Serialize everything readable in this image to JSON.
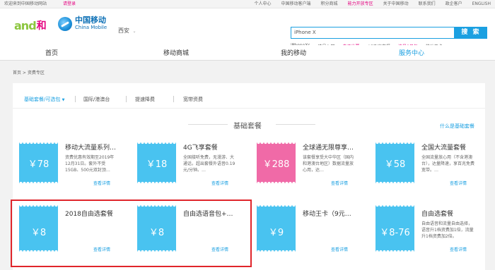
{
  "topbar": {
    "welcome": "欢迎来到中国移动网站",
    "login": "请登录",
    "links": [
      "个人中心",
      "中国移动客户端",
      "积分商城",
      "能力开放专区",
      "关于中国移动",
      "联系我们",
      "政企客户",
      "ENGLISH"
    ],
    "highlight_index": 3
  },
  "header": {
    "logo_and": "and",
    "logo_he": "和",
    "brand_cn": "中国移动",
    "brand_en": "China Mobile",
    "city": "西安",
    "search_value": "iPhone X",
    "search_button": "搜 索",
    "hotwords": [
      "iPhoneXs",
      "选号入网",
      "电子发票",
      "4G飞享套餐",
      "流量0日包",
      "移动王卡"
    ]
  },
  "nav": {
    "items": [
      "首页",
      "移动商城",
      "我的移动",
      "服务中心"
    ],
    "active_index": 3
  },
  "breadcrumb": "首页 > 资费专区",
  "tabs": [
    "基础套餐/可选包",
    "国际/港澳台",
    "提速降费",
    "宽带资费"
  ],
  "section": {
    "title": "基础套餐",
    "link": "什么是基础套餐"
  },
  "detail_label": "查看详情",
  "cards": [
    {
      "name": "移动大流量系列…",
      "price": "￥78",
      "desc": "资费优惠有效期至2019年12月31日。套外不受15GB、500元双封顶…"
    },
    {
      "name": "4G飞享套餐",
      "price": "￥18",
      "desc": "全国接听免费，无漫游、大通话，超出套餐外语音0.19元/分钟。…"
    },
    {
      "name": "全球通无限尊享…",
      "price": "￥288",
      "desc": "该套餐享受大中华区（国内和港澳台地区）数据流量放心用，达…"
    },
    {
      "name": "全国大流量套餐",
      "price": "￥58",
      "desc": "全国流量放心用（不含港澳台），达量降速，享百兆免费宽带。…"
    },
    {
      "name": "2018自由选套餐",
      "price": "￥8",
      "desc": ""
    },
    {
      "name": "自由选语音包+…",
      "price": "￥8",
      "desc": ""
    },
    {
      "name": "移动王卡（9元…",
      "price": "￥9",
      "desc": ""
    },
    {
      "name": "自由选套餐",
      "price": "￥8-76",
      "desc": "自由语音和流量自由选择，语音升1档资费加1倍，流量升1档资费加2倍。"
    }
  ],
  "colors": {
    "accent": "#1ba0e1",
    "pink": "#e4007f",
    "ticket_blue": "#49c3f0",
    "ticket_pink": "#f06aa7",
    "highlight_frame": "#e0252b"
  }
}
